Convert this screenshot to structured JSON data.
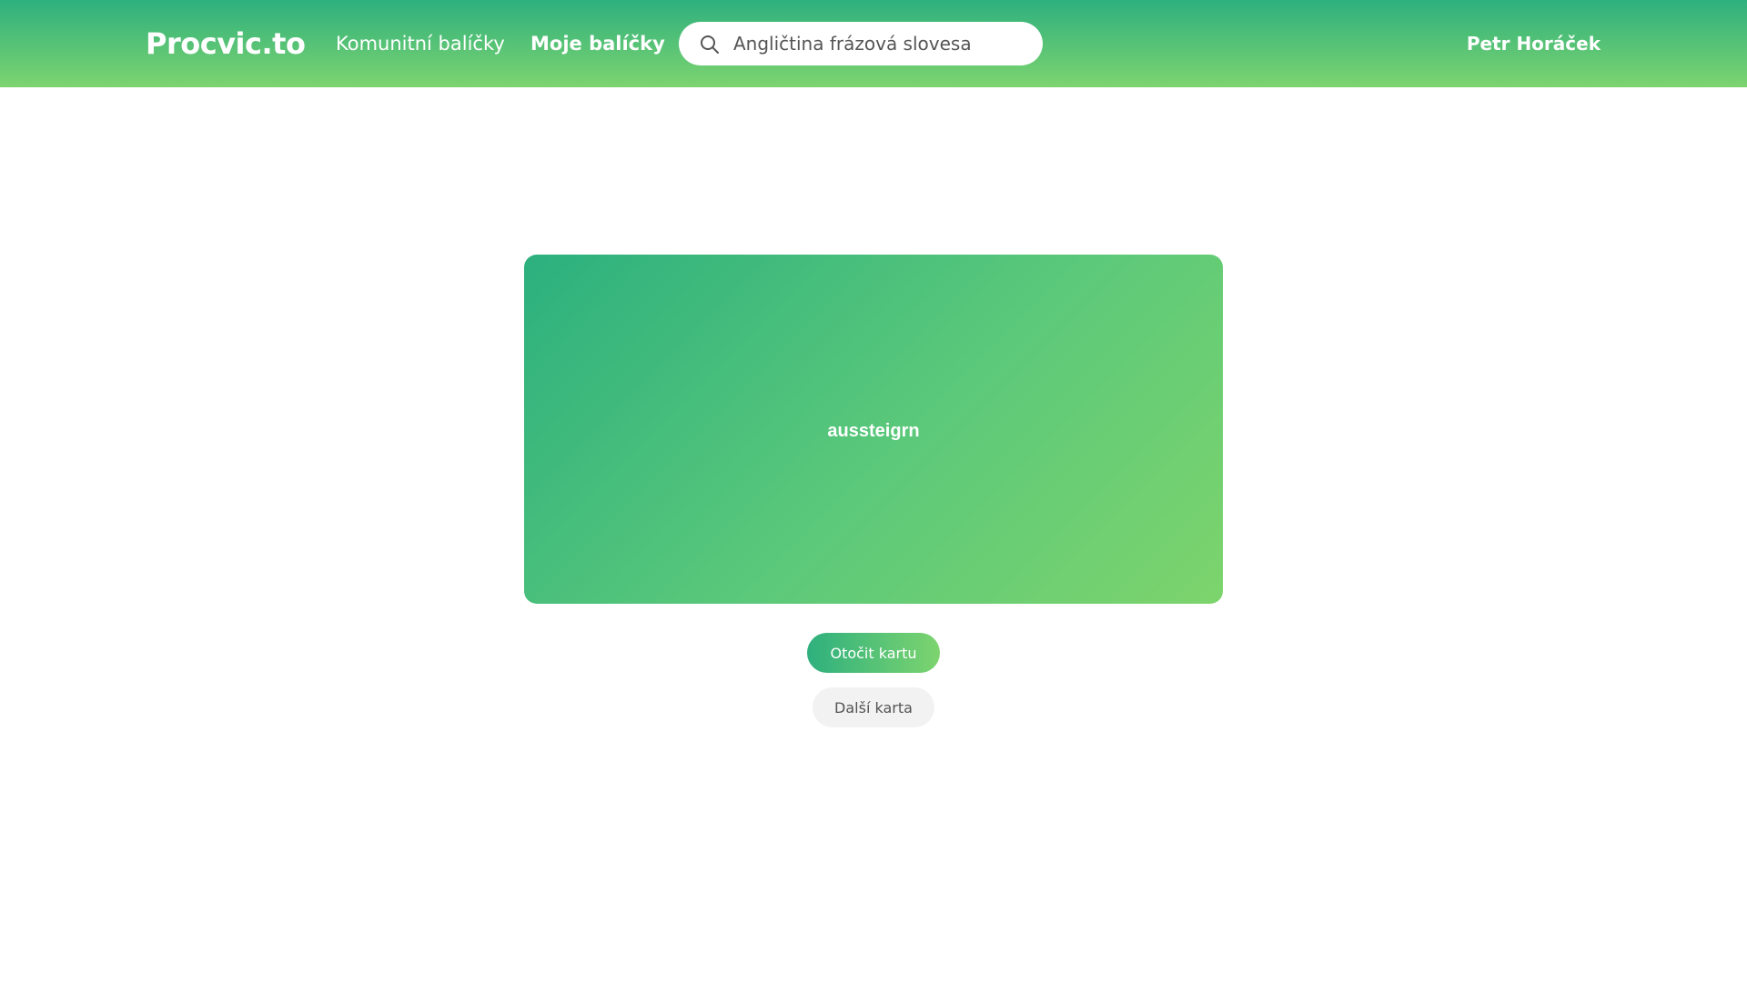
{
  "header": {
    "logo": "Procvic.to",
    "nav": {
      "community": "Komunitní balíčky",
      "mine": "Moje balíčky"
    },
    "search": {
      "value": "Angličtina frázová slovesa",
      "icon": "search-icon"
    },
    "user_name": "Petr Horáček"
  },
  "card": {
    "term": "aussteigrn"
  },
  "actions": {
    "flip_label": "Otočit kartu",
    "next_label": "Další karta"
  },
  "colors": {
    "brand_start": "#2eb07e",
    "brand_end": "#7dd46f",
    "secondary_button_bg": "#f2f2f2"
  }
}
